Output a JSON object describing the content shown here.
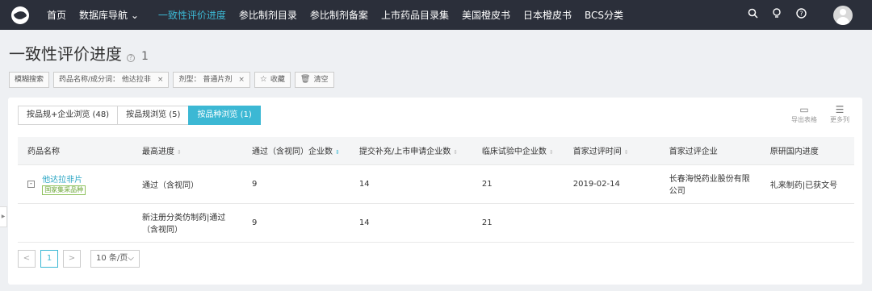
{
  "nav": {
    "items": [
      {
        "label": "首页"
      },
      {
        "label": "数据库导航 ⌄"
      },
      {
        "label": "一致性评价进度"
      },
      {
        "label": "参比制剂目录"
      },
      {
        "label": "参比制剂备案"
      },
      {
        "label": "上市药品目录集"
      },
      {
        "label": "美国橙皮书"
      },
      {
        "label": "日本橙皮书"
      },
      {
        "label": "BCS分类"
      }
    ],
    "active_color": "#3cb8d4"
  },
  "page": {
    "title": "一致性评价进度",
    "help_glyph": "?",
    "count": "1"
  },
  "filters": {
    "fuzzy": "模糊搜索",
    "chip1": "药品名称/成分词：  他达拉非",
    "chip2": "剂型：  普通片剂",
    "favorite": "收藏",
    "clear": "清空",
    "close_glyph": "×"
  },
  "tabs": [
    {
      "label": "按品规+企业浏览 (48)"
    },
    {
      "label": "按品规浏览 (5)"
    },
    {
      "label": "按品种浏览 (1)"
    }
  ],
  "tools": {
    "export": "导出表格",
    "more": "更多列"
  },
  "table": {
    "headers": [
      "药品名称",
      "最高进度",
      "通过（含视同）企业数",
      "提交补充/上市申请企业数",
      "临床试验中企业数",
      "首家过评时间",
      "首家过评企业",
      "原研国内进度"
    ],
    "rows": [
      {
        "expand": "-",
        "name": "他达拉非片",
        "badge": "国家集采品种",
        "progress": "通过（含视同）",
        "passed": "9",
        "submitted": "14",
        "clinical": "21",
        "first_time": "2019-02-14",
        "first_company": "长春海悦药业股份有限公司",
        "original": "礼来制药|已获文号"
      },
      {
        "progress": "新注册分类仿制药|通过（含视同）",
        "passed": "9",
        "submitted": "14",
        "clinical": "21"
      }
    ]
  },
  "pager": {
    "prev": "<",
    "page": "1",
    "next": ">",
    "size": "10 条/页⌵"
  }
}
